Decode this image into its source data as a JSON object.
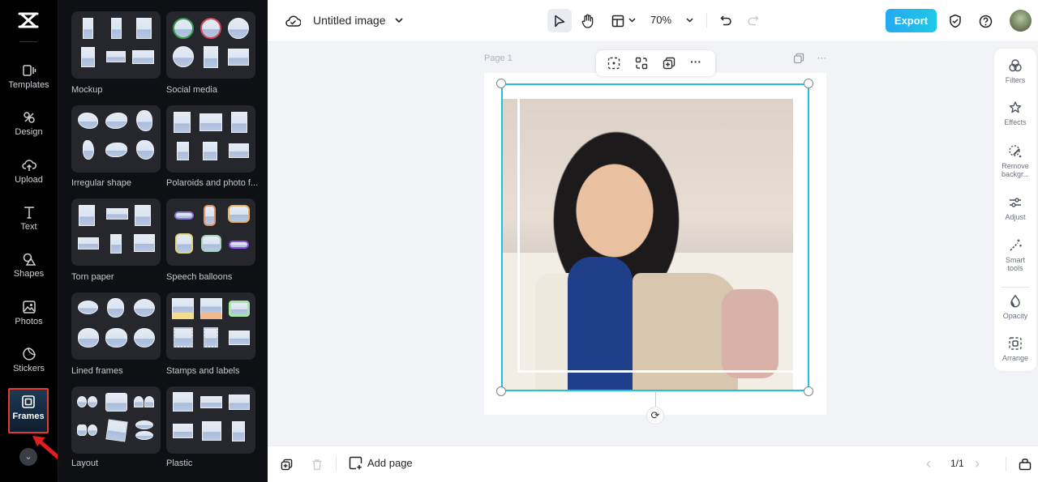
{
  "app": {
    "title": "Untitled image"
  },
  "rail": {
    "items": [
      {
        "label": "Templates",
        "icon": "templates-icon"
      },
      {
        "label": "Design",
        "icon": "design-icon"
      },
      {
        "label": "Upload",
        "icon": "upload-icon"
      },
      {
        "label": "Text",
        "icon": "text-icon"
      },
      {
        "label": "Shapes",
        "icon": "shapes-icon"
      },
      {
        "label": "Photos",
        "icon": "photos-icon"
      },
      {
        "label": "Stickers",
        "icon": "stickers-icon"
      },
      {
        "label": "Frames",
        "icon": "frames-icon",
        "active": true
      }
    ],
    "more_label": "⌄"
  },
  "panel": {
    "categories": [
      {
        "label": "Mockup"
      },
      {
        "label": "Social media"
      },
      {
        "label": "Irregular shape"
      },
      {
        "label": "Polaroids and photo f..."
      },
      {
        "label": "Torn paper"
      },
      {
        "label": "Speech balloons"
      },
      {
        "label": "Lined frames"
      },
      {
        "label": "Stamps and labels"
      },
      {
        "label": "Layout"
      },
      {
        "label": "Plastic"
      }
    ],
    "collapse_glyph": "‹"
  },
  "topbar": {
    "zoom_level": "70%",
    "export_label": "Export",
    "accent_color": "#20c3dc"
  },
  "canvas": {
    "page_label": "Page 1",
    "more_glyph": "···",
    "rotate_glyph": "⟳"
  },
  "right_tools": [
    {
      "label": "Filters"
    },
    {
      "label": "Effects"
    },
    {
      "label": "Remove backgr..."
    },
    {
      "label": "Adjust"
    },
    {
      "label": "Smart tools"
    },
    {
      "label": "Opacity"
    },
    {
      "label": "Arrange"
    }
  ],
  "bottombar": {
    "add_page_label": "Add page",
    "pager": "1/1",
    "prev_glyph": "‹",
    "next_glyph": "›"
  }
}
